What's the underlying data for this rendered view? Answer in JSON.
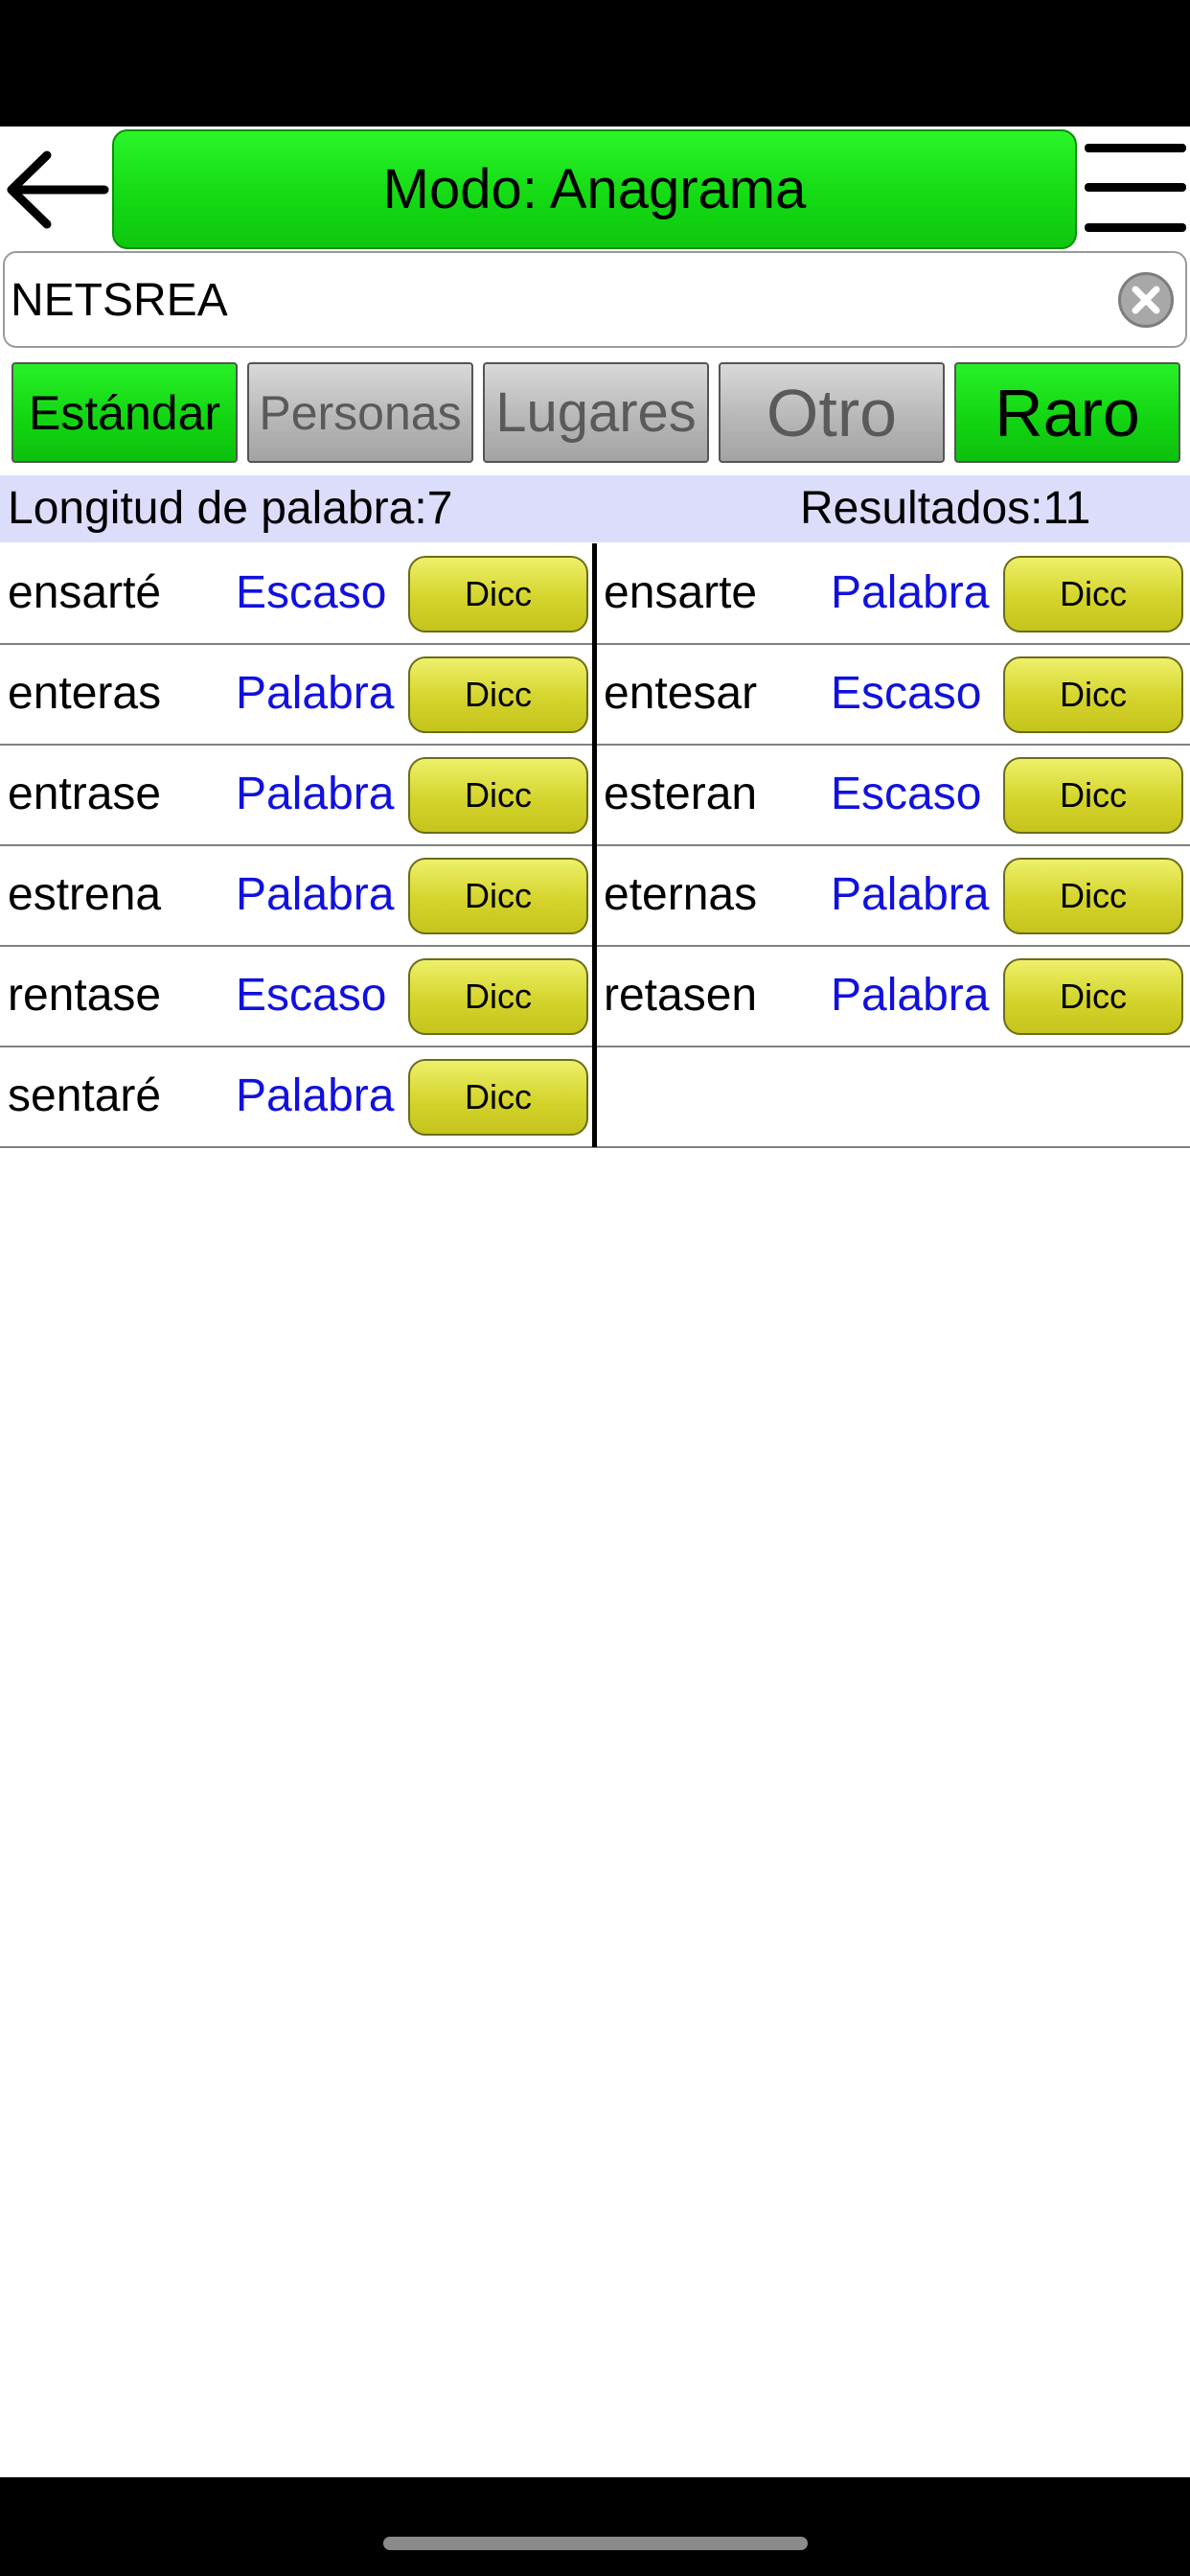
{
  "header": {
    "mode_label": "Modo: Anagrama"
  },
  "search": {
    "value": "NETSREA",
    "placeholder": ""
  },
  "categories": [
    {
      "label": "Estándar",
      "active": true
    },
    {
      "label": "Personas",
      "active": false
    },
    {
      "label": "Lugares",
      "active": false
    },
    {
      "label": "Otro",
      "active": false
    },
    {
      "label": "Raro",
      "active": true
    }
  ],
  "info": {
    "length_label": "Longitud de palabra:7",
    "results_label": "Resultados:11"
  },
  "results": [
    {
      "word": "ensarté",
      "type": "Escaso",
      "button": "Dicc"
    },
    {
      "word": "ensarte",
      "type": "Palabra",
      "button": "Dicc"
    },
    {
      "word": "enteras",
      "type": "Palabra",
      "button": "Dicc"
    },
    {
      "word": "entesar",
      "type": "Escaso",
      "button": "Dicc"
    },
    {
      "word": "entrase",
      "type": "Palabra",
      "button": "Dicc"
    },
    {
      "word": "esteran",
      "type": "Escaso",
      "button": "Dicc"
    },
    {
      "word": "estrena",
      "type": "Palabra",
      "button": "Dicc"
    },
    {
      "word": "eternas",
      "type": "Palabra",
      "button": "Dicc"
    },
    {
      "word": "rentase",
      "type": "Escaso",
      "button": "Dicc"
    },
    {
      "word": "retasen",
      "type": "Palabra",
      "button": "Dicc"
    },
    {
      "word": "sentaré",
      "type": "Palabra",
      "button": "Dicc"
    }
  ],
  "colors": {
    "mode_button": "#13d813",
    "active_category": "#12d612",
    "inactive_category": "#b8b8b8",
    "info_bar": "#dcdcfb",
    "type_text": "#1111dd",
    "dicc_button": "#d4d42c"
  },
  "icons": {
    "back": "arrow-left-icon",
    "menu": "hamburger-menu-icon",
    "clear": "clear-circle-x-icon"
  }
}
